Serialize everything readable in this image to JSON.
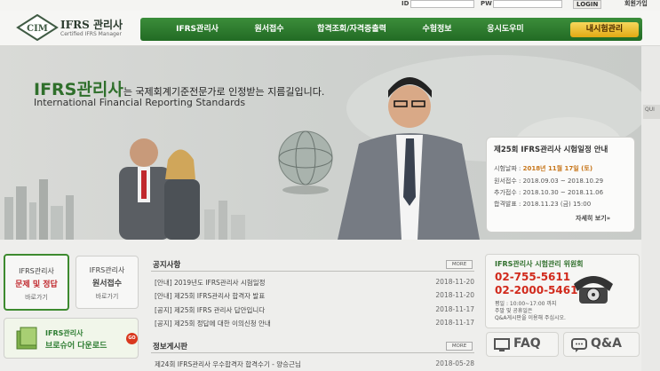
{
  "topbar": {
    "id_label": "ID",
    "pw_label": "PW",
    "login": "LOGIN",
    "join": "회원가입"
  },
  "header": {
    "logo_text": "IFRS 관리사",
    "logo_sub": "Certified IFRS Manager"
  },
  "nav": {
    "items": [
      "IFRS관리사",
      "원서접수",
      "합격조회/자격증출력",
      "수험정보",
      "응시도우미"
    ],
    "special": "내시험관리"
  },
  "hero": {
    "tag_big": "IFRS관리사",
    "tag_rest": "는 국제회계기준전문가로 인정받는 지름길입니다.",
    "subtitle": "International Financial Reporting Standards"
  },
  "schedule": {
    "title": "제25회 IFRS관리사 시험일정 안내",
    "rows": [
      {
        "label": "시험날짜",
        "value": "2018년 11월 17일 (토)"
      },
      {
        "label": "원서접수",
        "value": "2018.09.03 ~ 2018.10.29"
      },
      {
        "label": "추가접수",
        "value": "2018.10.30 ~ 2018.11.06"
      },
      {
        "label": "합격발표",
        "value": "2018.11.23 (금) 15:00"
      }
    ],
    "more": "자세히 보기»"
  },
  "tiles": {
    "tile1": {
      "l1": "IFRS관리사",
      "l2": "문제 및 정답",
      "l3": "바로가기"
    },
    "tile2": {
      "l1": "IFRS관리사",
      "l2": "원서접수",
      "l3": "바로가기"
    },
    "brochure_l1": "IFRS관리사",
    "brochure_l2": "브로슈어 다운로드",
    "go": "GO"
  },
  "notices": {
    "title": "공지사항",
    "more": "MORE",
    "items": [
      {
        "text": "[안내] 2019년도 IFRS관리사 시험일정",
        "date": "2018-11-20"
      },
      {
        "text": "[안내] 제25회 IFRS관리사 합격자 발표",
        "date": "2018-11-20"
      },
      {
        "text": "[공지] 제25회 IFRS 관리사 답안입니다",
        "date": "2018-11-17"
      },
      {
        "text": "[공지] 제25회 정답에 대한 이의신청 안내",
        "date": "2018-11-17"
      }
    ]
  },
  "board": {
    "title": "정보게시판",
    "more": "MORE",
    "items": [
      {
        "text": "제24회 IFRS관리사 우수합격자 합격수기 - 양승근님",
        "date": "2018-05-28"
      }
    ]
  },
  "contact": {
    "title": "IFRS관리사 시험관리 위원회",
    "phone1": "02-755-5611",
    "phone2": "02-2000-5461",
    "note1": "평일 : 10:00~17:00 까지",
    "note2": "주말 및 공휴일은",
    "note3": "Q&A게시판을 이용해 주십시오."
  },
  "faq": {
    "label": "FAQ"
  },
  "qna": {
    "label": "Q&A"
  },
  "side": {
    "label": "QUI"
  }
}
